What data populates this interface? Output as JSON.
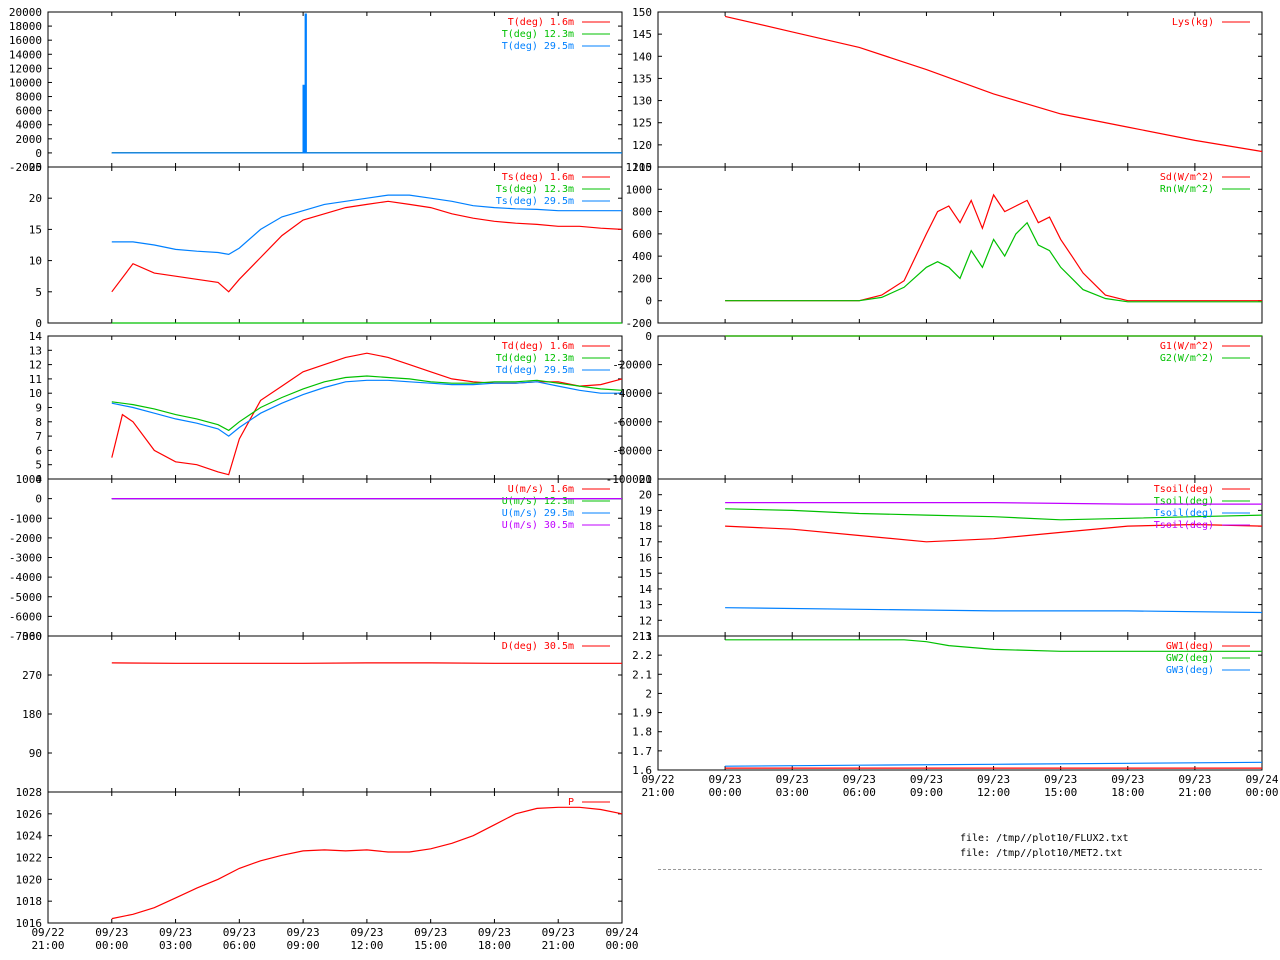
{
  "files": [
    "file: /tmp//plot10/FLUX2.txt",
    "file: /tmp//plot10/MET2.txt"
  ],
  "colors": {
    "red": "#ff0000",
    "green": "#00c000",
    "blue": "#0080ff",
    "magenta": "#c000ff"
  },
  "xaxis": {
    "ticks": [
      "09/22 21:00",
      "09/23 00:00",
      "09/23 03:00",
      "09/23 06:00",
      "09/23 09:00",
      "09/23 12:00",
      "09/23 15:00",
      "09/23 18:00",
      "09/23 21:00",
      "09/24 00:00"
    ],
    "range_hours": [
      -3,
      24
    ],
    "unit": "hours since 09/23 00:00"
  },
  "chart_data": [
    {
      "id": "left-1",
      "type": "line",
      "ylim": [
        -2000,
        20000
      ],
      "yticks": [
        "-2000",
        "0",
        "2000",
        "4000",
        "6000",
        "8000",
        "10000",
        "12000",
        "14000",
        "16000",
        "18000",
        "20000"
      ],
      "series": [
        {
          "name": "T(deg)  1.6m",
          "color": "#ff0000",
          "x": [
            0,
            24
          ],
          "y": [
            0,
            0
          ]
        },
        {
          "name": "T(deg) 12.3m",
          "color": "#00c000",
          "x": [
            0,
            24
          ],
          "y": [
            0,
            0
          ]
        },
        {
          "name": "T(deg) 29.5m",
          "color": "#0080ff",
          "x": [
            0,
            9.0,
            9.0,
            9.05,
            9.05,
            9.1,
            9.1,
            9.15,
            9.15,
            24
          ],
          "y": [
            0,
            0,
            9600,
            9600,
            0,
            0,
            19700,
            19700,
            0,
            0
          ]
        }
      ]
    },
    {
      "id": "left-2",
      "type": "line",
      "ylim": [
        0,
        25
      ],
      "yticks": [
        "0",
        "5",
        "10",
        "15",
        "20",
        "25"
      ],
      "series": [
        {
          "name": "Ts(deg)  1.6m",
          "color": "#ff0000",
          "x": [
            0,
            1,
            2,
            3,
            4,
            5,
            5.5,
            6,
            7,
            8,
            9,
            10,
            11,
            12,
            13,
            14,
            15,
            16,
            17,
            18,
            19,
            20,
            21,
            22,
            23,
            24
          ],
          "y": [
            5,
            9.5,
            8,
            7.5,
            7,
            6.5,
            5,
            7,
            10.5,
            14,
            16.5,
            17.5,
            18.5,
            19,
            19.5,
            19,
            18.5,
            17.5,
            16.8,
            16.3,
            16,
            15.8,
            15.5,
            15.5,
            15.2,
            15
          ]
        },
        {
          "name": "Ts(deg) 12.3m",
          "color": "#00c000",
          "x": [
            0,
            24
          ],
          "y": [
            0,
            0
          ]
        },
        {
          "name": "Ts(deg) 29.5m",
          "color": "#0080ff",
          "x": [
            0,
            1,
            2,
            3,
            4,
            5,
            5.5,
            6,
            7,
            8,
            9,
            10,
            11,
            12,
            13,
            14,
            15,
            16,
            17,
            18,
            19,
            20,
            21,
            22,
            23,
            24
          ],
          "y": [
            13,
            13,
            12.5,
            11.8,
            11.5,
            11.3,
            11,
            12,
            15,
            17,
            18,
            19,
            19.5,
            20,
            20.5,
            20.5,
            20,
            19.5,
            18.8,
            18.5,
            18.3,
            18.2,
            18,
            18,
            18,
            18
          ]
        }
      ]
    },
    {
      "id": "left-3",
      "type": "line",
      "ylim": [
        4,
        14
      ],
      "yticks": [
        "4",
        "5",
        "6",
        "7",
        "8",
        "9",
        "10",
        "11",
        "12",
        "13",
        "14"
      ],
      "series": [
        {
          "name": "Td(deg)  1.6m",
          "color": "#ff0000",
          "x": [
            0,
            0.5,
            1,
            2,
            3,
            4,
            5,
            5.5,
            6,
            7,
            8,
            9,
            10,
            11,
            12,
            13,
            14,
            15,
            16,
            17,
            18,
            19,
            20,
            21,
            22,
            23,
            24
          ],
          "y": [
            5.5,
            8.5,
            8,
            6,
            5.2,
            5,
            4.5,
            4.3,
            6.8,
            9.5,
            10.5,
            11.5,
            12,
            12.5,
            12.8,
            12.5,
            12,
            11.5,
            11,
            10.8,
            10.7,
            10.7,
            10.8,
            10.8,
            10.5,
            10.6,
            11
          ]
        },
        {
          "name": "Td(deg) 12.3m",
          "color": "#00c000",
          "x": [
            0,
            1,
            2,
            3,
            4,
            5,
            5.5,
            6,
            7,
            8,
            9,
            10,
            11,
            12,
            13,
            14,
            15,
            16,
            17,
            18,
            19,
            20,
            21,
            22,
            23,
            24
          ],
          "y": [
            9.4,
            9.2,
            8.9,
            8.5,
            8.2,
            7.8,
            7.4,
            8,
            9,
            9.7,
            10.3,
            10.8,
            11.1,
            11.2,
            11.1,
            11,
            10.8,
            10.7,
            10.7,
            10.8,
            10.8,
            10.9,
            10.7,
            10.5,
            10.3,
            10.2
          ]
        },
        {
          "name": "Td(deg) 29.5m",
          "color": "#0080ff",
          "x": [
            0,
            1,
            2,
            3,
            4,
            5,
            5.5,
            6,
            7,
            8,
            9,
            10,
            11,
            12,
            13,
            14,
            15,
            16,
            17,
            18,
            19,
            20,
            21,
            22,
            23,
            24
          ],
          "y": [
            9.3,
            9,
            8.6,
            8.2,
            7.9,
            7.5,
            7,
            7.6,
            8.6,
            9.3,
            9.9,
            10.4,
            10.8,
            10.9,
            10.9,
            10.8,
            10.7,
            10.6,
            10.6,
            10.7,
            10.7,
            10.8,
            10.5,
            10.2,
            10,
            10
          ]
        }
      ]
    },
    {
      "id": "left-4",
      "type": "line",
      "ylim": [
        -7000,
        1000
      ],
      "yticks": [
        "-7000",
        "-6000",
        "-5000",
        "-4000",
        "-3000",
        "-2000",
        "-1000",
        "0",
        "1000"
      ],
      "series": [
        {
          "name": "U(m/s)  1.6m",
          "color": "#ff0000",
          "x": [
            0,
            24
          ],
          "y": [
            0,
            0
          ]
        },
        {
          "name": "U(m/s) 12.3m",
          "color": "#00c000",
          "x": [
            0,
            24
          ],
          "y": [
            0,
            0
          ]
        },
        {
          "name": "U(m/s) 29.5m",
          "color": "#0080ff",
          "x": [
            0,
            24
          ],
          "y": [
            0,
            0
          ]
        },
        {
          "name": "U(m/s) 30.5m",
          "color": "#c000ff",
          "x": [
            0,
            24
          ],
          "y": [
            0,
            0
          ]
        }
      ]
    },
    {
      "id": "left-5",
      "type": "line",
      "ylim": [
        0,
        360
      ],
      "yticks": [
        "",
        "90",
        "180",
        "270",
        "360"
      ],
      "series": [
        {
          "name": "D(deg)  30.5m",
          "color": "#ff0000",
          "x": [
            0,
            3,
            6,
            9,
            12,
            15,
            18,
            21,
            24
          ],
          "y": [
            298,
            297,
            297,
            297,
            298,
            298,
            297,
            297,
            297
          ]
        }
      ]
    },
    {
      "id": "left-6",
      "type": "line",
      "ylim": [
        1016,
        1028
      ],
      "yticks": [
        "1016",
        "1018",
        "1020",
        "1022",
        "1024",
        "1026",
        "1028"
      ],
      "series": [
        {
          "name": "P",
          "color": "#ff0000",
          "x": [
            0,
            1,
            2,
            3,
            4,
            5,
            6,
            7,
            8,
            9,
            10,
            11,
            12,
            13,
            14,
            15,
            16,
            17,
            18,
            19,
            20,
            21,
            22,
            23,
            24
          ],
          "y": [
            1016.4,
            1016.8,
            1017.4,
            1018.3,
            1019.2,
            1020,
            1021,
            1021.7,
            1022.2,
            1022.6,
            1022.7,
            1022.6,
            1022.7,
            1022.5,
            1022.5,
            1022.8,
            1023.3,
            1024,
            1025,
            1026,
            1026.5,
            1026.6,
            1026.6,
            1026.4,
            1026
          ]
        }
      ]
    },
    {
      "id": "right-1",
      "type": "line",
      "ylim": [
        115,
        150
      ],
      "yticks": [
        "115",
        "120",
        "125",
        "130",
        "135",
        "140",
        "145",
        "150"
      ],
      "series": [
        {
          "name": "Lys(kg)",
          "color": "#ff0000",
          "x": [
            0,
            3,
            6,
            9,
            12,
            15,
            18,
            21,
            24
          ],
          "y": [
            149,
            145.5,
            142,
            137,
            131.5,
            127,
            124,
            121,
            118.5
          ]
        }
      ]
    },
    {
      "id": "right-2",
      "type": "line",
      "ylim": [
        -200,
        1200
      ],
      "yticks": [
        "-200",
        "0",
        "200",
        "400",
        "600",
        "800",
        "1000",
        "1200"
      ],
      "series": [
        {
          "name": "Sd(W/m^2)",
          "color": "#ff0000",
          "x": [
            0,
            6,
            7,
            8,
            9,
            9.5,
            10,
            10.5,
            11,
            11.5,
            12,
            12.5,
            13,
            13.5,
            14,
            14.5,
            15,
            15.5,
            16,
            17,
            18,
            24
          ],
          "y": [
            0,
            0,
            50,
            180,
            600,
            800,
            850,
            700,
            900,
            650,
            950,
            800,
            850,
            900,
            700,
            750,
            550,
            400,
            250,
            50,
            0,
            0
          ]
        },
        {
          "name": "Rn(W/m^2)",
          "color": "#00c000",
          "x": [
            0,
            6,
            7,
            8,
            9,
            9.5,
            10,
            10.5,
            11,
            11.5,
            12,
            12.5,
            13,
            13.5,
            14,
            14.5,
            15,
            15.5,
            16,
            17,
            18,
            24
          ],
          "y": [
            0,
            0,
            30,
            120,
            300,
            350,
            300,
            200,
            450,
            300,
            550,
            400,
            600,
            700,
            500,
            450,
            300,
            200,
            100,
            20,
            -10,
            -10
          ]
        }
      ]
    },
    {
      "id": "right-3",
      "type": "line",
      "ylim": [
        -100000,
        0
      ],
      "yticks": [
        "-100000",
        "-80000",
        "-60000",
        "-40000",
        "-20000",
        "0"
      ],
      "series": [
        {
          "name": "G1(W/m^2)",
          "color": "#ff0000",
          "x": [
            0,
            24
          ],
          "y": [
            0,
            0
          ]
        },
        {
          "name": "G2(W/m^2)",
          "color": "#00c000",
          "x": [
            0,
            24
          ],
          "y": [
            0,
            0
          ]
        }
      ]
    },
    {
      "id": "right-4",
      "type": "line",
      "ylim": [
        11,
        21
      ],
      "yticks": [
        "11",
        "12",
        "13",
        "14",
        "15",
        "16",
        "17",
        "18",
        "19",
        "20",
        "21"
      ],
      "series": [
        {
          "name": "Tsoil(deg)",
          "color": "#ff0000",
          "x": [
            0,
            3,
            6,
            9,
            12,
            15,
            18,
            21,
            24
          ],
          "y": [
            18,
            17.8,
            17.4,
            17,
            17.2,
            17.6,
            18,
            18.1,
            18
          ]
        },
        {
          "name": "Tsoil(deg)",
          "color": "#00c000",
          "x": [
            0,
            3,
            6,
            9,
            12,
            15,
            18,
            21,
            24
          ],
          "y": [
            19.1,
            19,
            18.8,
            18.7,
            18.6,
            18.4,
            18.5,
            18.6,
            18.7
          ]
        },
        {
          "name": "Tsoil(deg)",
          "color": "#0080ff",
          "x": [
            0,
            6,
            12,
            18,
            24
          ],
          "y": [
            12.8,
            12.7,
            12.6,
            12.6,
            12.5
          ]
        },
        {
          "name": "Tsoil(deg)",
          "color": "#c000ff",
          "x": [
            0,
            6,
            12,
            18,
            24
          ],
          "y": [
            19.5,
            19.5,
            19.5,
            19.4,
            19.4
          ]
        }
      ]
    },
    {
      "id": "right-5",
      "type": "line",
      "ylim": [
        1.6,
        2.3
      ],
      "yticks": [
        "1.6",
        "1.7",
        "1.8",
        "1.9",
        "2",
        "2.1",
        "2.2",
        "2.3"
      ],
      "series": [
        {
          "name": "GW1(deg)",
          "color": "#ff0000",
          "x": [
            0,
            6,
            12,
            18,
            24
          ],
          "y": [
            1.61,
            1.61,
            1.61,
            1.61,
            1.61
          ]
        },
        {
          "name": "GW2(deg)",
          "color": "#00c000",
          "x": [
            0,
            6,
            8,
            9,
            10,
            12,
            15,
            18,
            21,
            24
          ],
          "y": [
            2.28,
            2.28,
            2.28,
            2.27,
            2.25,
            2.23,
            2.22,
            2.22,
            2.22,
            2.22
          ]
        },
        {
          "name": "GW3(deg)",
          "color": "#0080ff",
          "x": [
            0,
            6,
            12,
            18,
            24
          ],
          "y": [
            1.62,
            1.625,
            1.63,
            1.635,
            1.64
          ]
        }
      ]
    }
  ]
}
